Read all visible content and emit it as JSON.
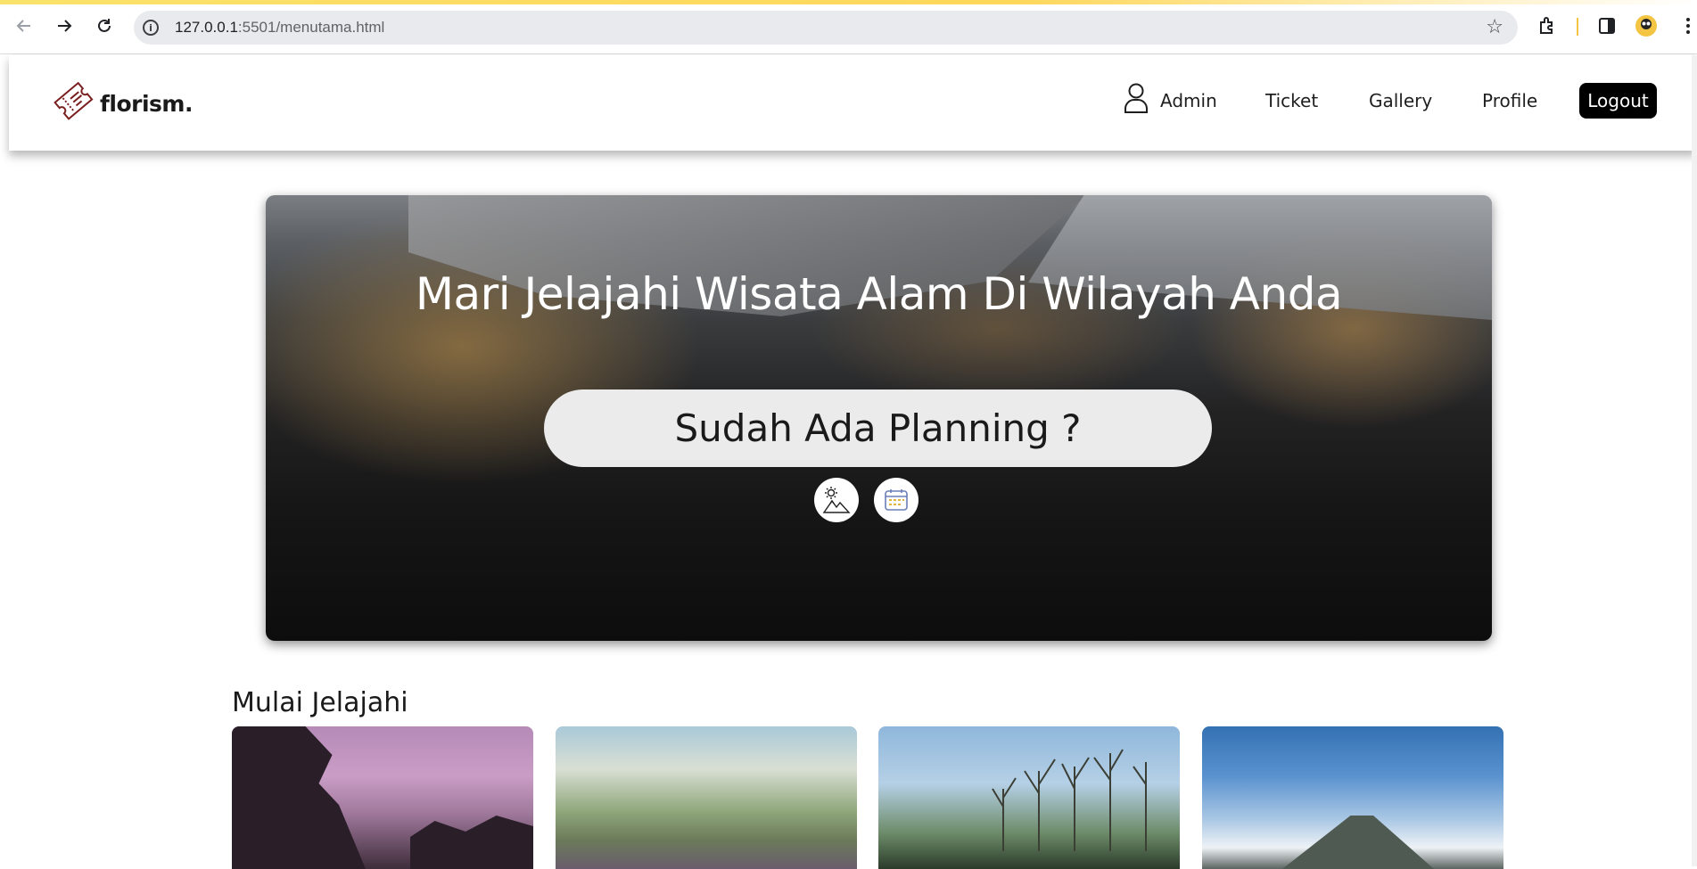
{
  "browser": {
    "url_host": "127.0.0.1",
    "url_path": ":5501/menutama.html",
    "icons": [
      "back-icon",
      "forward-icon",
      "reload-icon",
      "site-info-icon",
      "bookmark-star-icon",
      "extensions-icon",
      "side-panel-icon",
      "profile-avatar-icon",
      "more-menu-icon"
    ]
  },
  "header": {
    "logo_text": "florism.",
    "nav": {
      "admin": "Admin",
      "ticket": "Ticket",
      "gallery": "Gallery",
      "profile": "Profile"
    },
    "logout_label": "Logout"
  },
  "hero": {
    "title": "Mari Jelajahi Wisata Alam Di Wilayah Anda",
    "planning_button": "Sudah Ada Planning ?",
    "icons": [
      "mountain-sun-icon",
      "calendar-icon"
    ]
  },
  "explore": {
    "title": "Mulai Jelajahi",
    "cards": [
      "purple-cliff-sunset",
      "valley-landscape",
      "lake-with-trees",
      "volcano-above-clouds"
    ]
  },
  "colors": {
    "logo_accent": "#7a1f1f",
    "logout_bg": "#000000",
    "planning_bg": "#ebebeb"
  }
}
